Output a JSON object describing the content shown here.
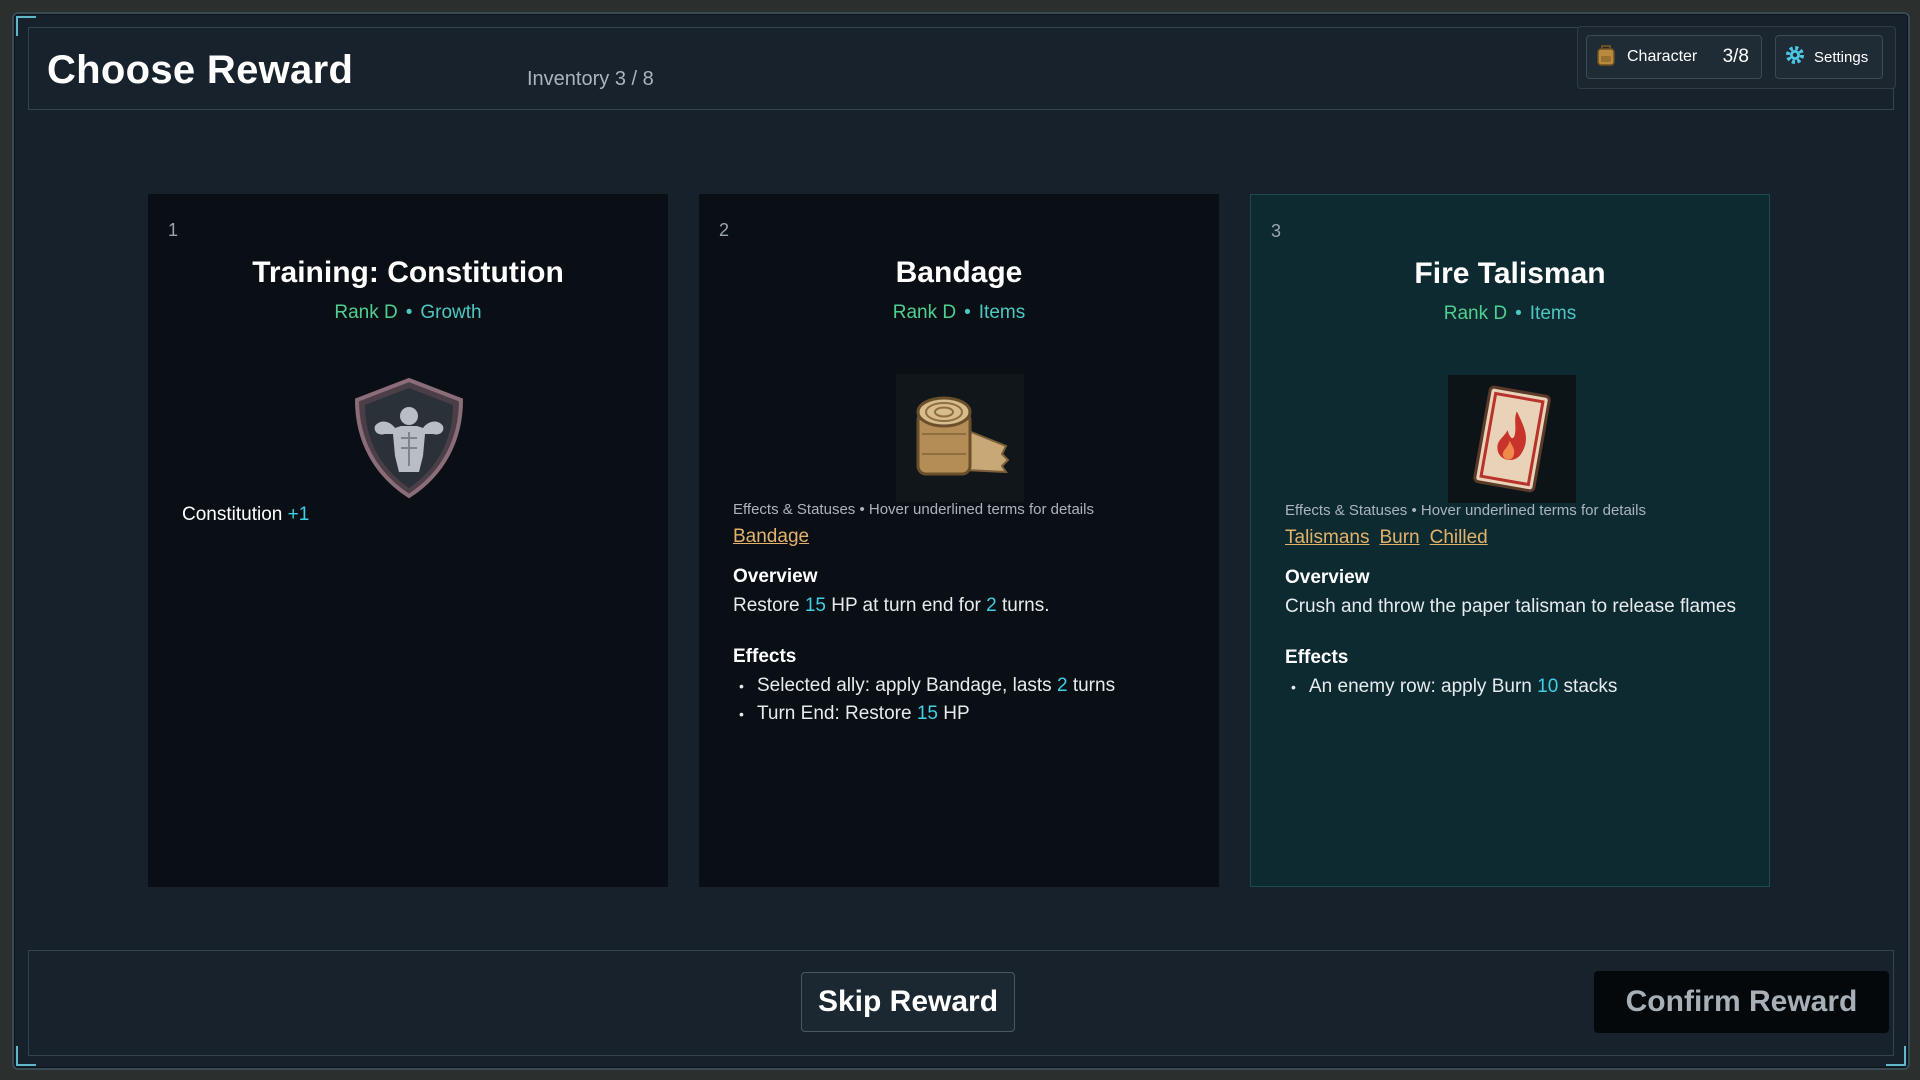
{
  "header": {
    "title": "Choose Reward",
    "inventory": "Inventory 3 / 8"
  },
  "top_bar": {
    "character_label": "Character",
    "character_count": "3/8",
    "settings_label": "Settings"
  },
  "cards": [
    {
      "number": "1",
      "name": "Training: Constitution",
      "rank": "Rank D",
      "separator": "•",
      "category": "Growth",
      "icon": "strength-shield-icon",
      "stat_name": "Constitution",
      "stat_value": "+1"
    },
    {
      "number": "2",
      "name": "Bandage",
      "rank": "Rank D",
      "separator": "•",
      "category": "Items",
      "icon": "bandage-roll-icon",
      "hint": "Effects & Statuses  •  Hover underlined terms for details",
      "terms": [
        "Bandage"
      ],
      "overview_title": "Overview",
      "overview": {
        "pre": "Restore ",
        "n1": "15",
        "mid": " HP at turn end for ",
        "n2": "2",
        "post": " turns."
      },
      "effects_title": "Effects",
      "effects": [
        {
          "pre": "Selected ally: apply Bandage, lasts ",
          "n": "2",
          "post": " turns"
        },
        {
          "pre": "Turn End: Restore ",
          "n": "15",
          "post": " HP"
        }
      ]
    },
    {
      "number": "3",
      "name": "Fire Talisman",
      "rank": "Rank D",
      "separator": "•",
      "category": "Items",
      "icon": "fire-talisman-icon",
      "selected": true,
      "hint": "Effects & Statuses  •  Hover underlined terms for details",
      "terms": [
        "Talismans",
        "Burn",
        "Chilled"
      ],
      "overview_title": "Overview",
      "overview": "Crush and throw the paper talisman to release flames",
      "effects_title": "Effects",
      "effects": [
        {
          "pre": "An enemy row: apply Burn ",
          "n": "10",
          "post": " stacks"
        }
      ]
    }
  ],
  "footer": {
    "skip_label": "Skip Reward",
    "confirm_label": "Confirm Reward"
  },
  "colors": {
    "accent_cyan": "#3fd0e6",
    "rank_green": "#4fcf8f",
    "term_gold": "#e2b26b",
    "selected_card": "#0e2a31"
  }
}
